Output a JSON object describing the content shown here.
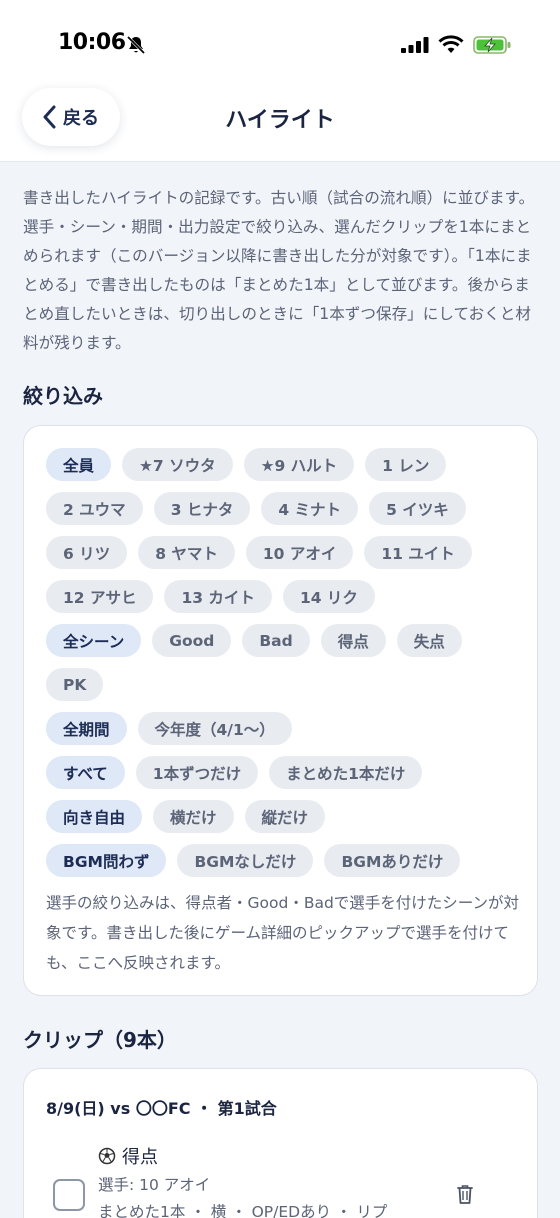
{
  "status_bar": {
    "time": "10:06"
  },
  "nav": {
    "back_label": "戻る",
    "title": "ハイライト"
  },
  "intro_text": "書き出したハイライトの記録です。古い順（試合の流れ順）に並びます。選手・シーン・期間・出力設定で絞り込み、選んだクリップを1本にまとめられます（このバージョン以降に書き出した分が対象です）。「1本にまとめる」で書き出したものは「まとめた1本」として並びます。後からまとめ直したいときは、切り出しのときに「1本ずつ保存」にしておくと材料が残ります。",
  "filter_section": {
    "title": "絞り込み",
    "players": [
      "全員",
      "★7 ソウタ",
      "★9 ハルト",
      "1 レン",
      "2 ユウマ",
      "3 ヒナタ",
      "4 ミナト",
      "5 イツキ",
      "6 リツ",
      "8 ヤマト",
      "10 アオイ",
      "11 ユイト",
      "12 アサヒ",
      "13 カイト",
      "14 リク"
    ],
    "scenes": [
      "全シーン",
      "Good",
      "Bad",
      "得点",
      "失点",
      "PK"
    ],
    "periods": [
      "全期間",
      "今年度（4/1〜）"
    ],
    "output": [
      "すべて",
      "1本ずつだけ",
      "まとめた1本だけ"
    ],
    "orientation": [
      "向き自由",
      "横だけ",
      "縦だけ"
    ],
    "bgm": [
      "BGM問わず",
      "BGMなしだけ",
      "BGMありだけ"
    ],
    "note": "選手の絞り込みは、得点者・Good・Badで選手を付けたシーンが対象です。書き出した後にゲーム詳細のピックアップで選手を付けても、ここへ反映されます。"
  },
  "clips_section": {
    "title": "クリップ（9本）",
    "clip": {
      "header": "8/9(日) vs 〇〇FC ・ 第1試合",
      "scene": "得点",
      "player": "選手: 10 アオイ",
      "meta": "まとめた1本 ・ 横 ・ OP/EDあり ・ リプ"
    }
  }
}
